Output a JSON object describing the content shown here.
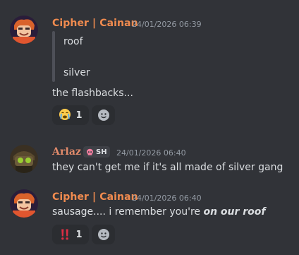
{
  "colors": {
    "cipher_name": "#f08b4f",
    "arlaz_name": "#e28b6b",
    "background": "#313338"
  },
  "messages": [
    {
      "author": "Cipher | Cainan",
      "timestamp": "24/01/2026 06:39",
      "quote_lines": [
        "roof",
        "silver"
      ],
      "text": "the flashbacks...",
      "reactions": [
        {
          "emoji": "crying-face",
          "glyph": "😭",
          "count": "1"
        }
      ],
      "avatar_icon": "red-haired-character-avatar-icon"
    },
    {
      "author": "Arlaz",
      "badge_tag": "SH",
      "badge_icon": "skull-icon",
      "timestamp": "24/01/2026 06:40",
      "text": "they can't get me if it's all made of silver gang",
      "avatar_icon": "goggles-character-avatar-icon"
    },
    {
      "author": "Cipher | Cainan",
      "timestamp": "24/01/2026 06:40",
      "text_prefix": "sausage.... i remember you're ",
      "text_emphasis": "on our roof",
      "reactions": [
        {
          "emoji": "double-exclamation",
          "glyph": "‼",
          "count": "1"
        }
      ],
      "avatar_icon": "red-haired-character-avatar-icon"
    }
  ]
}
